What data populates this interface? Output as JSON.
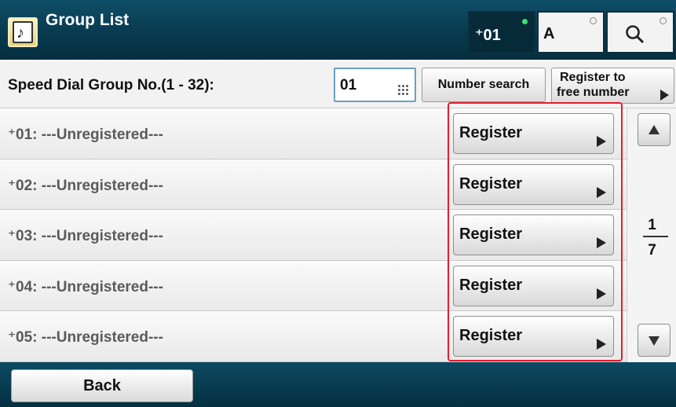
{
  "titlebar": {
    "title": "Group List",
    "mode_dial_label": "⁺01",
    "mode_alpha_label": "A"
  },
  "search": {
    "label": "Speed Dial Group No.(1 - 32):",
    "value": "01",
    "number_search_label": "Number search",
    "register_free_line1": "Register to",
    "register_free_line2": "free number"
  },
  "rows": [
    {
      "label": "⁺01: ---Unregistered---",
      "button": "Register"
    },
    {
      "label": "⁺02: ---Unregistered---",
      "button": "Register"
    },
    {
      "label": "⁺03: ---Unregistered---",
      "button": "Register"
    },
    {
      "label": "⁺04: ---Unregistered---",
      "button": "Register"
    },
    {
      "label": "⁺05: ---Unregistered---",
      "button": "Register"
    }
  ],
  "pager": {
    "current": "1",
    "total": "7"
  },
  "footer": {
    "back_label": "Back"
  },
  "colors": {
    "titlebar": "#083a4f",
    "highlight": "#e41e2a",
    "active_indicator": "#3fe07a"
  },
  "icons": [
    "document-icon",
    "search-icon",
    "keypad-icon",
    "arrow-right-icon",
    "arrow-up-icon",
    "arrow-down-icon"
  ]
}
